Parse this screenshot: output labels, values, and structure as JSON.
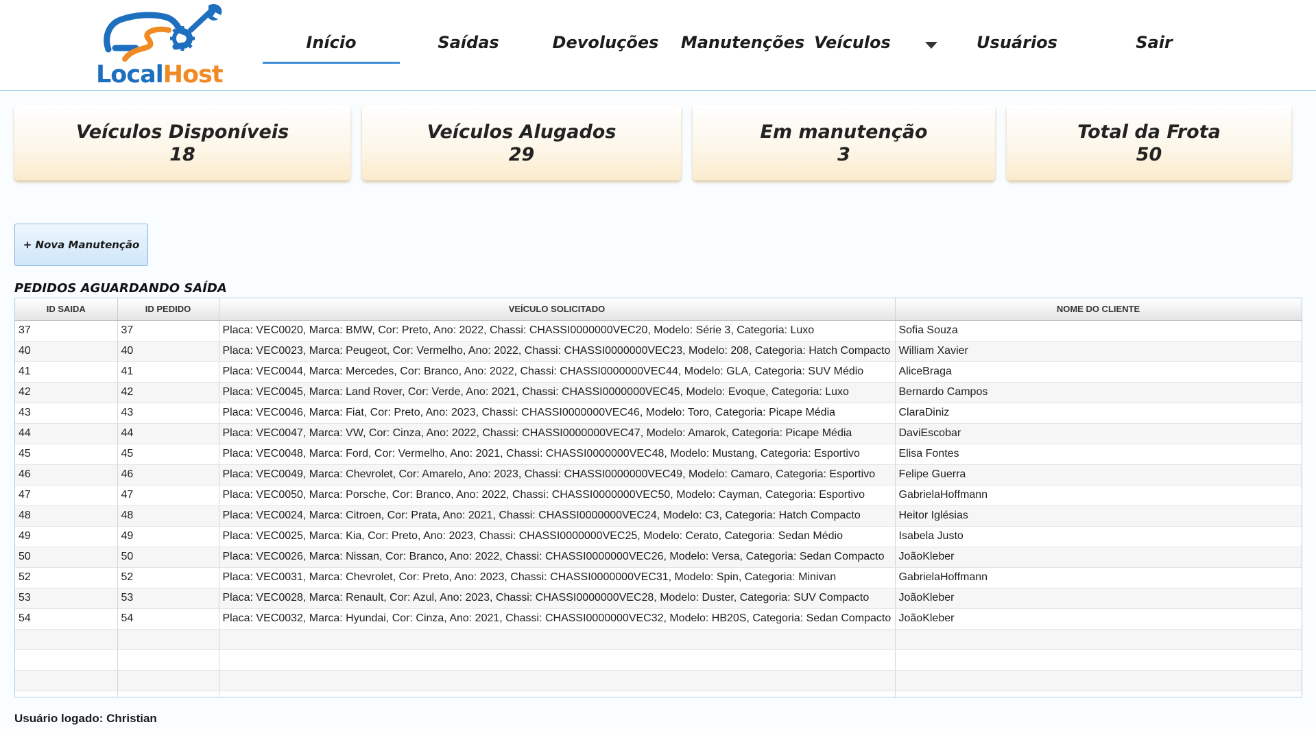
{
  "brand": {
    "name_part1": "Local",
    "name_part2": "Host"
  },
  "nav": {
    "items": [
      {
        "label": "Início"
      },
      {
        "label": "Saídas"
      },
      {
        "label": "Devoluções"
      },
      {
        "label": "Manutenções"
      },
      {
        "label": "Veículos"
      },
      {
        "label": "Usuários"
      },
      {
        "label": "Sair"
      }
    ],
    "active": "Início"
  },
  "stats": [
    {
      "label": "Veículos Disponíveis",
      "value": "18"
    },
    {
      "label": "Veículos Alugados",
      "value": "29"
    },
    {
      "label": "Em manutenção",
      "value": "3"
    },
    {
      "label": "Total da Frota",
      "value": "50"
    }
  ],
  "actions": {
    "new_maintenance": "+ Nova Manutenção"
  },
  "section": {
    "title": "PEDIDOS AGUARDANDO SAÍDA"
  },
  "table": {
    "headers": [
      "ID SAIDA",
      "ID PEDIDO",
      "VEÍCULO SOLICITADO",
      "NOME DO CLIENTE"
    ],
    "rows": [
      [
        "37",
        "37",
        "Placa: VEC0020, Marca: BMW, Cor: Preto, Ano: 2022, Chassi: CHASSI0000000VEC20, Modelo: Série 3, Categoria: Luxo",
        "Sofia Souza"
      ],
      [
        "40",
        "40",
        "Placa: VEC0023, Marca: Peugeot, Cor: Vermelho, Ano: 2022, Chassi: CHASSI0000000VEC23, Modelo: 208, Categoria: Hatch Compacto",
        "William Xavier"
      ],
      [
        "41",
        "41",
        "Placa: VEC0044, Marca: Mercedes, Cor: Branco, Ano: 2022, Chassi: CHASSI0000000VEC44, Modelo: GLA, Categoria: SUV Médio",
        "AliceBraga"
      ],
      [
        "42",
        "42",
        "Placa: VEC0045, Marca: Land Rover, Cor: Verde, Ano: 2021, Chassi: CHASSI0000000VEC45, Modelo: Evoque, Categoria: Luxo",
        "Bernardo Campos"
      ],
      [
        "43",
        "43",
        "Placa: VEC0046, Marca: Fiat, Cor: Preto, Ano: 2023, Chassi: CHASSI0000000VEC46, Modelo: Toro, Categoria: Picape Média",
        "ClaraDiniz"
      ],
      [
        "44",
        "44",
        "Placa: VEC0047, Marca: VW, Cor: Cinza, Ano: 2022, Chassi: CHASSI0000000VEC47, Modelo: Amarok, Categoria: Picape Média",
        "DaviEscobar"
      ],
      [
        "45",
        "45",
        "Placa: VEC0048, Marca: Ford, Cor: Vermelho, Ano: 2021, Chassi: CHASSI0000000VEC48, Modelo: Mustang, Categoria: Esportivo",
        "Elisa Fontes"
      ],
      [
        "46",
        "46",
        "Placa: VEC0049, Marca: Chevrolet, Cor: Amarelo, Ano: 2023, Chassi: CHASSI0000000VEC49, Modelo: Camaro, Categoria: Esportivo",
        "Felipe Guerra"
      ],
      [
        "47",
        "47",
        "Placa: VEC0050, Marca: Porsche, Cor: Branco, Ano: 2022, Chassi: CHASSI0000000VEC50, Modelo: Cayman, Categoria: Esportivo",
        "GabrielaHoffmann"
      ],
      [
        "48",
        "48",
        "Placa: VEC0024, Marca: Citroen, Cor: Prata, Ano: 2021, Chassi: CHASSI0000000VEC24, Modelo: C3, Categoria: Hatch Compacto",
        "Heitor Iglésias"
      ],
      [
        "49",
        "49",
        "Placa: VEC0025, Marca: Kia, Cor: Preto, Ano: 2023, Chassi: CHASSI0000000VEC25, Modelo: Cerato, Categoria: Sedan Médio",
        "Isabela Justo"
      ],
      [
        "50",
        "50",
        "Placa: VEC0026, Marca: Nissan, Cor: Branco, Ano: 2022, Chassi: CHASSI0000000VEC26, Modelo: Versa, Categoria: Sedan Compacto",
        "JoãoKleber"
      ],
      [
        "52",
        "52",
        "Placa: VEC0031, Marca: Chevrolet, Cor: Preto, Ano: 2023, Chassi: CHASSI0000000VEC31, Modelo: Spin, Categoria: Minivan",
        "GabrielaHoffmann"
      ],
      [
        "53",
        "53",
        "Placa: VEC0028, Marca: Renault, Cor: Azul, Ano: 2023, Chassi: CHASSI0000000VEC28, Modelo: Duster, Categoria: SUV Compacto",
        "JoãoKleber"
      ],
      [
        "54",
        "54",
        "Placa: VEC0032, Marca: Hyundai, Cor: Cinza, Ano: 2021, Chassi: CHASSI0000000VEC32, Modelo: HB20S, Categoria: Sedan Compacto",
        "JoãoKleber"
      ]
    ]
  },
  "footer": {
    "logged_user": "Usuário logado: Christian"
  },
  "colors": {
    "brand_blue": "#1f6fbf",
    "brand_orange": "#f08a24",
    "accent_line": "#3f8fd4"
  },
  "icons": {
    "logo": "car-wrench-gear-logo",
    "dropdown": "caret-down-icon"
  }
}
